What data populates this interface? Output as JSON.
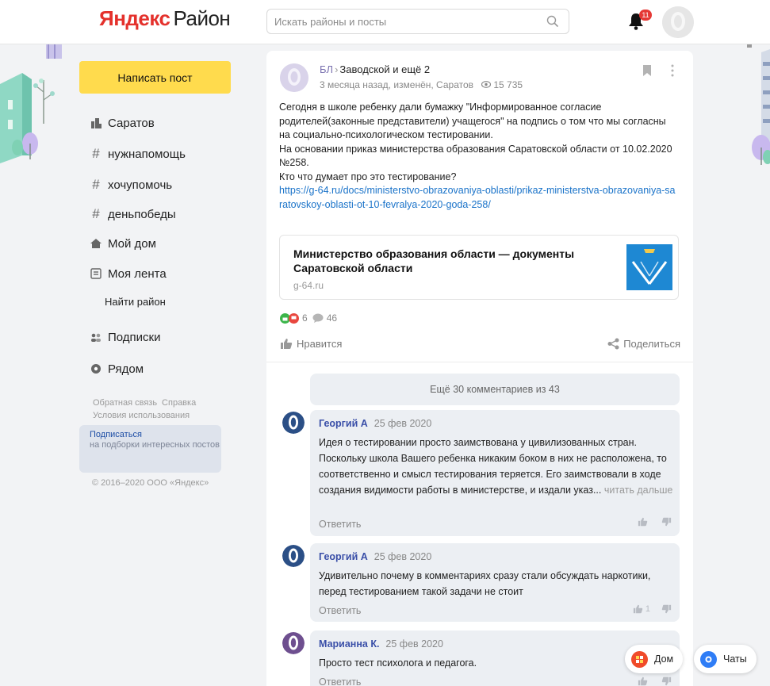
{
  "header": {
    "logo_brand": "Яндекс",
    "logo_product": "Район",
    "search_placeholder": "Искать районы и посты",
    "notification_count": "11"
  },
  "sidebar": {
    "write_button": "Написать пост",
    "items": [
      {
        "icon": "city-icon",
        "label": "Саратов"
      },
      {
        "icon": "hashtag-icon",
        "label": "нужнапомощь"
      },
      {
        "icon": "hashtag-icon",
        "label": "хочупомочь"
      },
      {
        "icon": "hashtag-icon",
        "label": "деньпобеды"
      },
      {
        "icon": "house-icon",
        "label": "Мой дом"
      },
      {
        "icon": "feed-icon",
        "label": "Моя лента"
      },
      {
        "icon": "",
        "label": "Найти район"
      },
      {
        "icon": "people-icon",
        "label": "Подписки"
      },
      {
        "icon": "location-icon",
        "label": "Рядом"
      }
    ],
    "footer_links": [
      "Обратная связь",
      "Справка",
      "Условия использования"
    ],
    "subscribe_link": "Подписаться",
    "subscribe_text": "на подборки интересных постов",
    "copyright": "© 2016–2020 ООО «Яндекс»"
  },
  "post": {
    "community_abbr": "БЛ",
    "community_name": "Заводской и ещё 2",
    "meta": "3 месяца назад, изменён, Саратов",
    "views": "15 735",
    "text": "Сегодня в школе ребенку дали бумажку \"Информированное согласие родителей(законные представители) учащегося\" на подпись о том что мы согласны на социально-психологическом тестировании.\nНа основании приказ министерства образования Саратовской области от 10.02.2020 №258.\nКто что думает про это тестирование?",
    "link": "https://g-64.ru/docs/ministerstvo-obrazovaniya-oblasti/prikaz-ministerstva-obrazovaniya-saratovskoy-oblasti-ot-10-fevralya-2020-goda-258/",
    "preview_title": "Министерство образования области — документы Саратовской области",
    "preview_domain": "g-64.ru",
    "reactions_count": "6",
    "comments_count": "46",
    "like_label": "Нравится",
    "share_label": "Поделиться"
  },
  "comments_more": "Ещё 30 комментариев из 43",
  "comments": [
    {
      "author": "Георгий А",
      "date": "25 фев 2020",
      "text": "Идея о тестировании просто заимствована у цивилизованных стран. Поскольку школа Вашего ребенка никаким боком в них не расположена, то соответственно и смысл тестирования теряется. Его заимствовали в ходе создания видимости работы в министерстве, и издали указ...",
      "more": "читать дальше",
      "reply": "Ответить",
      "likes": ""
    },
    {
      "author": "Георгий А",
      "date": "25 фев 2020",
      "text": "Удивительно почему в комментариях сразу стали обсуждать наркотики, перед тестированием такой задачи не стоит",
      "more": "",
      "reply": "Ответить",
      "likes": "1"
    },
    {
      "author": "Марианна К.",
      "date": "25 фев 2020",
      "text": "Просто тест психолога и педагога.",
      "more": "",
      "reply": "Ответить",
      "likes": ""
    }
  ],
  "floating": {
    "home_label": "Дом",
    "chats_label": "Чаты"
  }
}
